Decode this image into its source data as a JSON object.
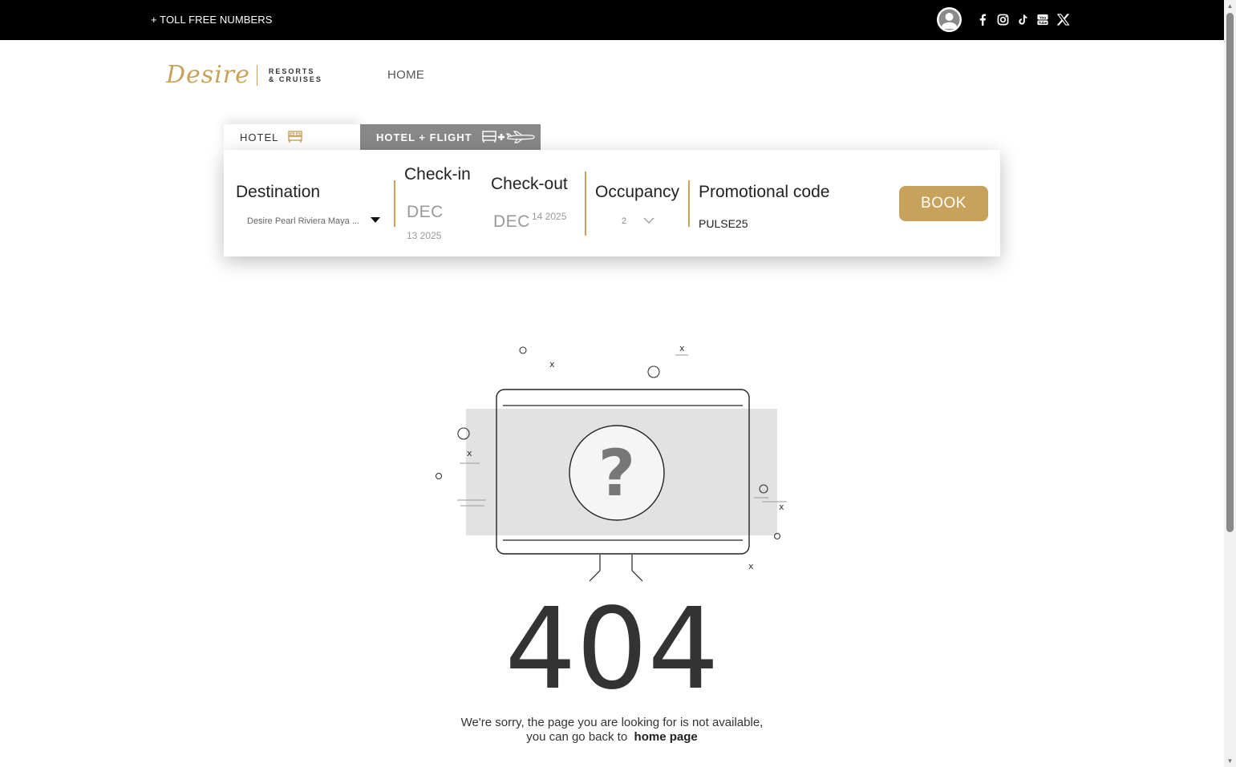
{
  "topbar": {
    "toll_free": "+ TOLL FREE NUMBERS",
    "social_icons": [
      "facebook-icon",
      "instagram-icon",
      "tiktok-icon",
      "youtube-icon",
      "x-icon"
    ]
  },
  "header": {
    "logo_script": "Desire",
    "logo_line1": "RESORTS",
    "logo_line2": "& CRUISES",
    "nav_home": "HOME"
  },
  "booking": {
    "tabs": [
      {
        "label": "HOTEL",
        "active": true
      },
      {
        "label": "HOTEL + FLIGHT",
        "active": false
      }
    ],
    "destination": {
      "label": "Destination",
      "value": "Desire Pearl Riviera Maya ..."
    },
    "checkin": {
      "label": "Check-in",
      "month": "DEC",
      "day_year": "13 2025"
    },
    "checkout": {
      "label": "Check-out",
      "month": "DEC",
      "day_year": "14 2025"
    },
    "occupancy": {
      "label": "Occupancy",
      "value": "2"
    },
    "promo": {
      "label": "Promotional code",
      "value": "PULSE25"
    },
    "book_label": "BOOK"
  },
  "error": {
    "code": "404",
    "question": "?",
    "message_line1": "We're sorry, the page you are looking for is not available,",
    "message_line2": "you can go back to",
    "home_link": "home page"
  },
  "colors": {
    "accent": "#c8a15a",
    "topbar": "#000000",
    "tab_inactive": "#888888"
  }
}
